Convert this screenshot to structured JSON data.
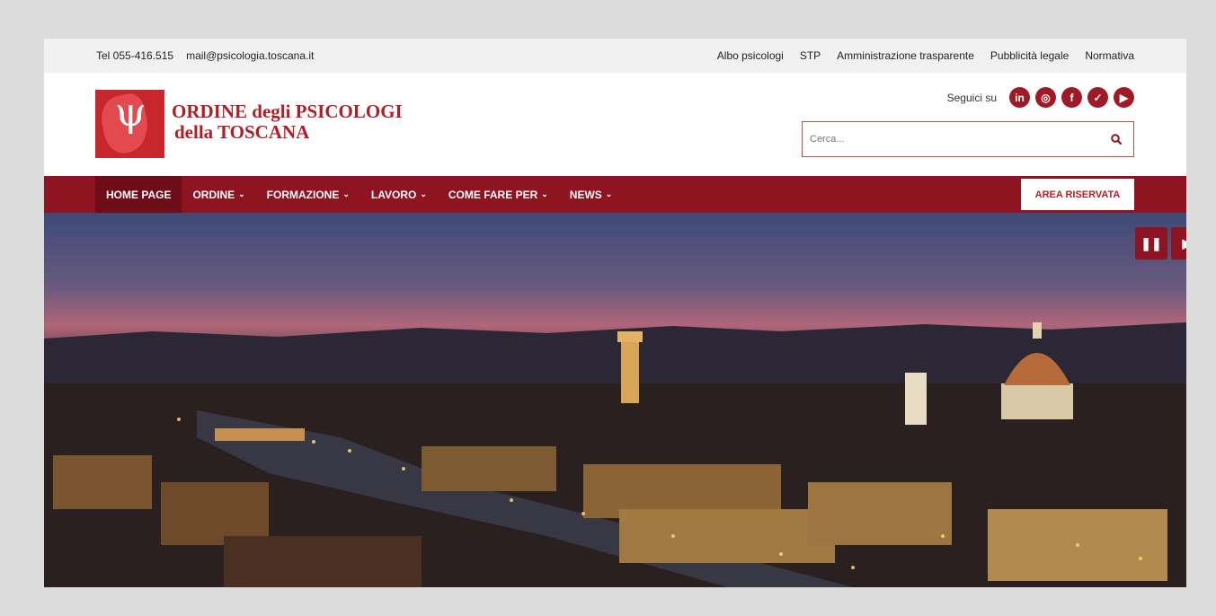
{
  "topbar": {
    "phone": "Tel 055-416.515",
    "email": "mail@psicologia.toscana.it",
    "links": [
      "Albo psicologi",
      "STP",
      "Amministrazione trasparente",
      "Pubblicità legale",
      "Normativa"
    ]
  },
  "header": {
    "logo_line1": "ORDINE degli PSICOLOGI",
    "logo_line2": "della TOSCANA",
    "logo_symbol": "ψ",
    "follow_label": "Seguici su",
    "social": [
      {
        "icon": "linkedin-icon",
        "glyph": "in"
      },
      {
        "icon": "instagram-icon",
        "glyph": "◎"
      },
      {
        "icon": "facebook-icon",
        "glyph": "f"
      },
      {
        "icon": "twitter-icon",
        "glyph": "✓"
      },
      {
        "icon": "youtube-icon",
        "glyph": "▶"
      }
    ],
    "search_placeholder": "Cerca..."
  },
  "nav": {
    "items": [
      {
        "label": "HOME PAGE",
        "dropdown": ""
      },
      {
        "label": "ORDINE",
        "dropdown": "⌄"
      },
      {
        "label": "FORMAZIONE",
        "dropdown": "⌄"
      },
      {
        "label": "LAVORO",
        "dropdown": "⌄"
      },
      {
        "label": "COME FARE PER",
        "dropdown": "⌄"
      },
      {
        "label": "NEWS",
        "dropdown": "⌄"
      }
    ],
    "area_riservata": "AREA RISERVATA"
  },
  "slider": {
    "pause_glyph": "❚❚",
    "next_glyph": "▶"
  },
  "colors": {
    "brand": "#8d1420",
    "logo_red": "#c8262d"
  }
}
